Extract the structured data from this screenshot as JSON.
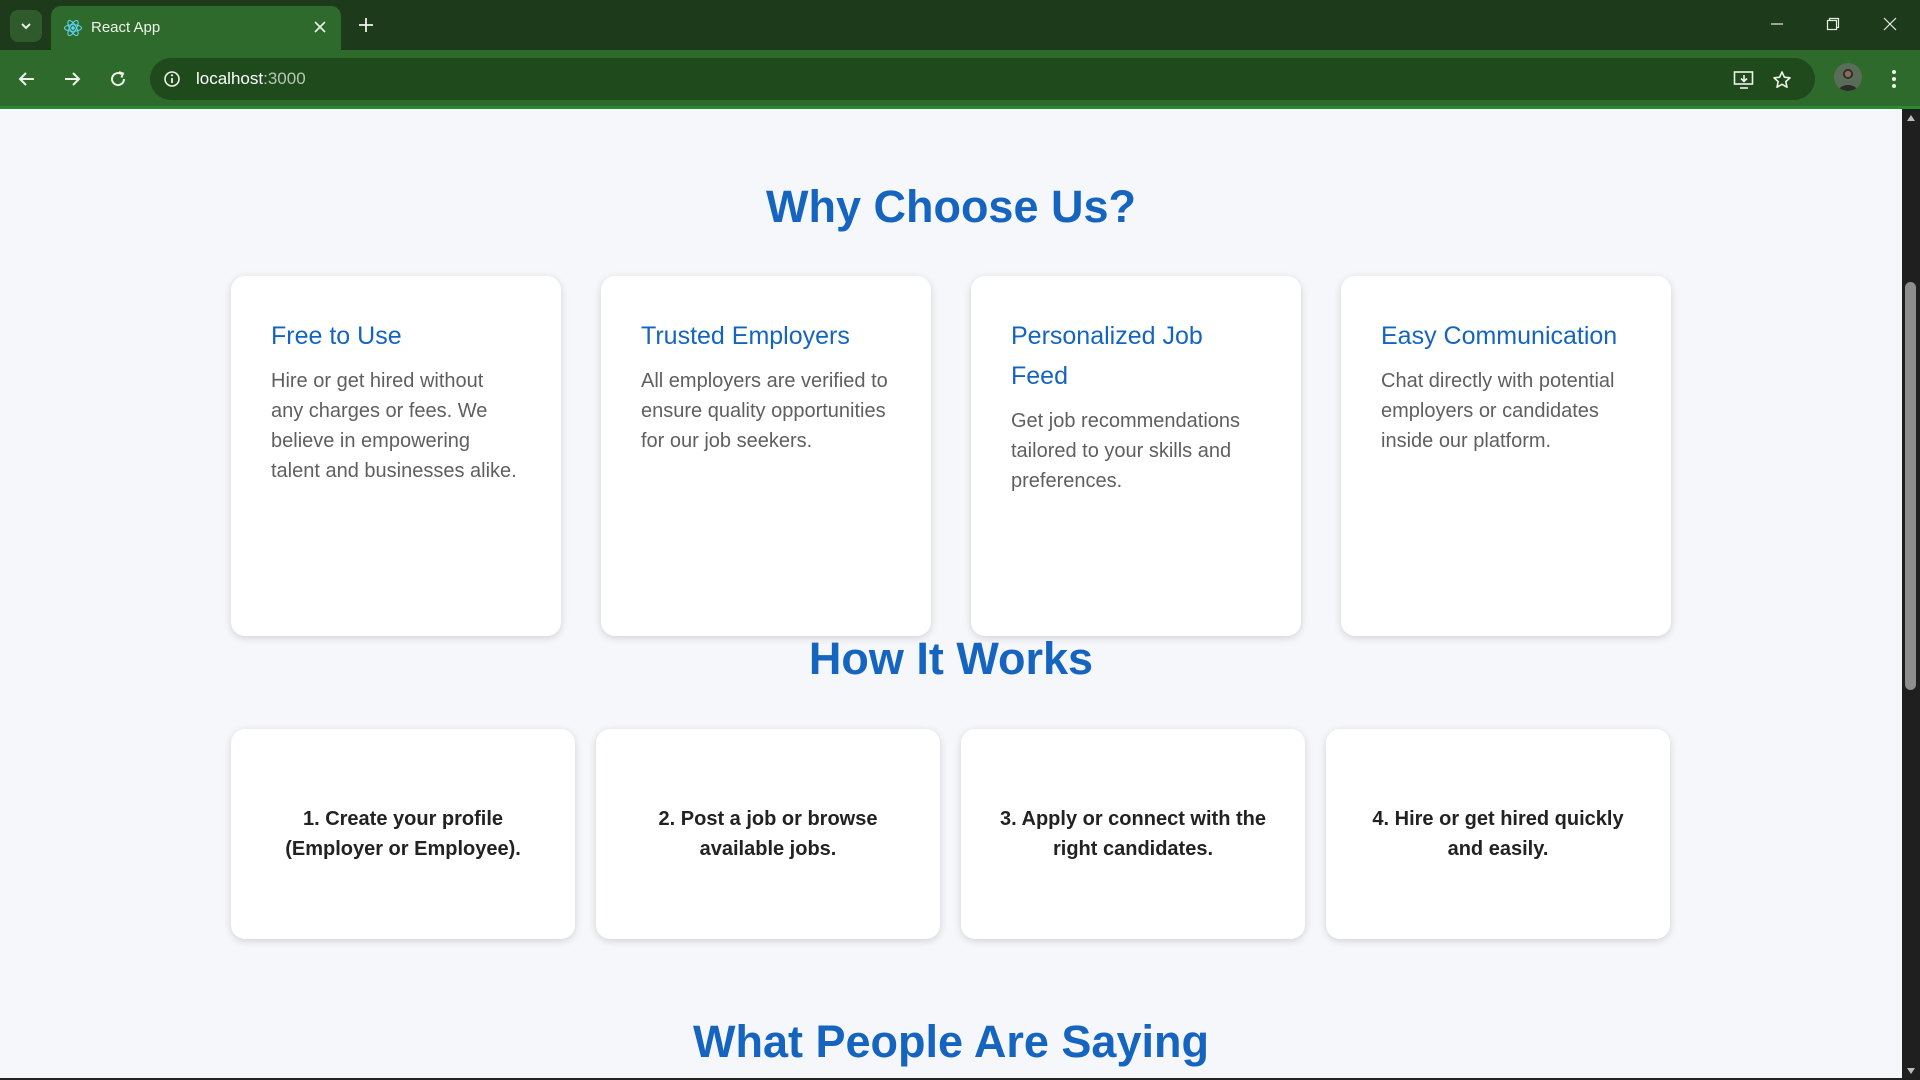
{
  "browser": {
    "tab_title": "React App",
    "url_host": "localhost",
    "url_port": ":3000"
  },
  "icons": {
    "tab_menu": "chevron-down-icon",
    "favicon": "react-logo-icon",
    "close_tab": "close-icon",
    "new_tab": "plus-icon",
    "minimize": "minimize-icon",
    "restore": "restore-icon",
    "close_window": "close-icon",
    "back": "arrow-left-icon",
    "forward": "arrow-right-icon",
    "reload": "reload-icon",
    "site_info": "info-icon",
    "install": "install-app-icon",
    "bookmark": "star-icon",
    "menu": "kebab-menu-icon"
  },
  "colors": {
    "tab_strip": "#1d3a1b",
    "toolbar": "#2e6a2c",
    "accent_blue": "#1565c0",
    "page_bg": "#f6f7fa"
  },
  "why_choose_us": {
    "title": "Why Choose Us?",
    "cards": [
      {
        "title": "Free to Use",
        "text": "Hire or get hired without any charges or fees. We believe in empowering talent and businesses alike."
      },
      {
        "title": "Trusted Employers",
        "text": "All employers are verified to ensure quality opportunities for our job seekers."
      },
      {
        "title": "Personalized Job Feed",
        "text": "Get job recommendations tailored to your skills and preferences."
      },
      {
        "title": "Easy Communication",
        "text": "Chat directly with potential employers or candidates inside our platform."
      }
    ]
  },
  "how_it_works": {
    "title": "How It Works",
    "steps": [
      "1. Create your profile (Employer or Employee).",
      "2. Post a job or browse available jobs.",
      "3. Apply or connect with the right candidates.",
      "4. Hire or get hired quickly and easily."
    ]
  },
  "testimonials": {
    "title": "What People Are Saying"
  }
}
